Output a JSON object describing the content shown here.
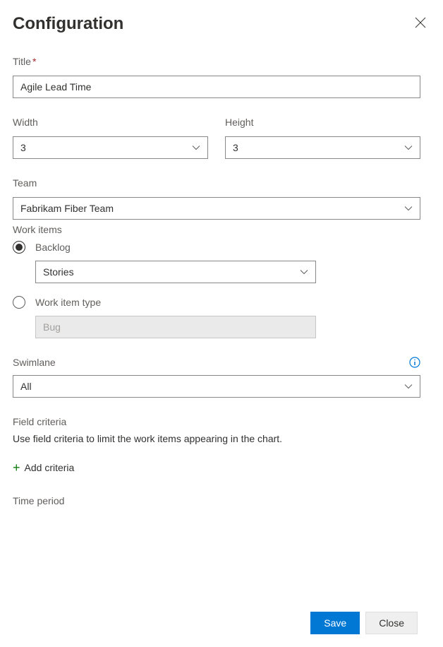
{
  "header": {
    "title": "Configuration"
  },
  "fields": {
    "title_label": "Title",
    "title_value": "Agile Lead Time",
    "width_label": "Width",
    "width_value": "3",
    "height_label": "Height",
    "height_value": "3",
    "team_label": "Team",
    "team_value": "Fabrikam Fiber Team",
    "work_items_label": "Work items",
    "backlog_radio_label": "Backlog",
    "backlog_value": "Stories",
    "wit_radio_label": "Work item type",
    "wit_value": "Bug",
    "swimlane_label": "Swimlane",
    "swimlane_value": "All",
    "field_criteria_label": "Field criteria",
    "field_criteria_desc": "Use field criteria to limit the work items appearing in the chart.",
    "add_criteria_label": "Add criteria",
    "time_period_label": "Time period"
  },
  "footer": {
    "save": "Save",
    "close": "Close"
  }
}
